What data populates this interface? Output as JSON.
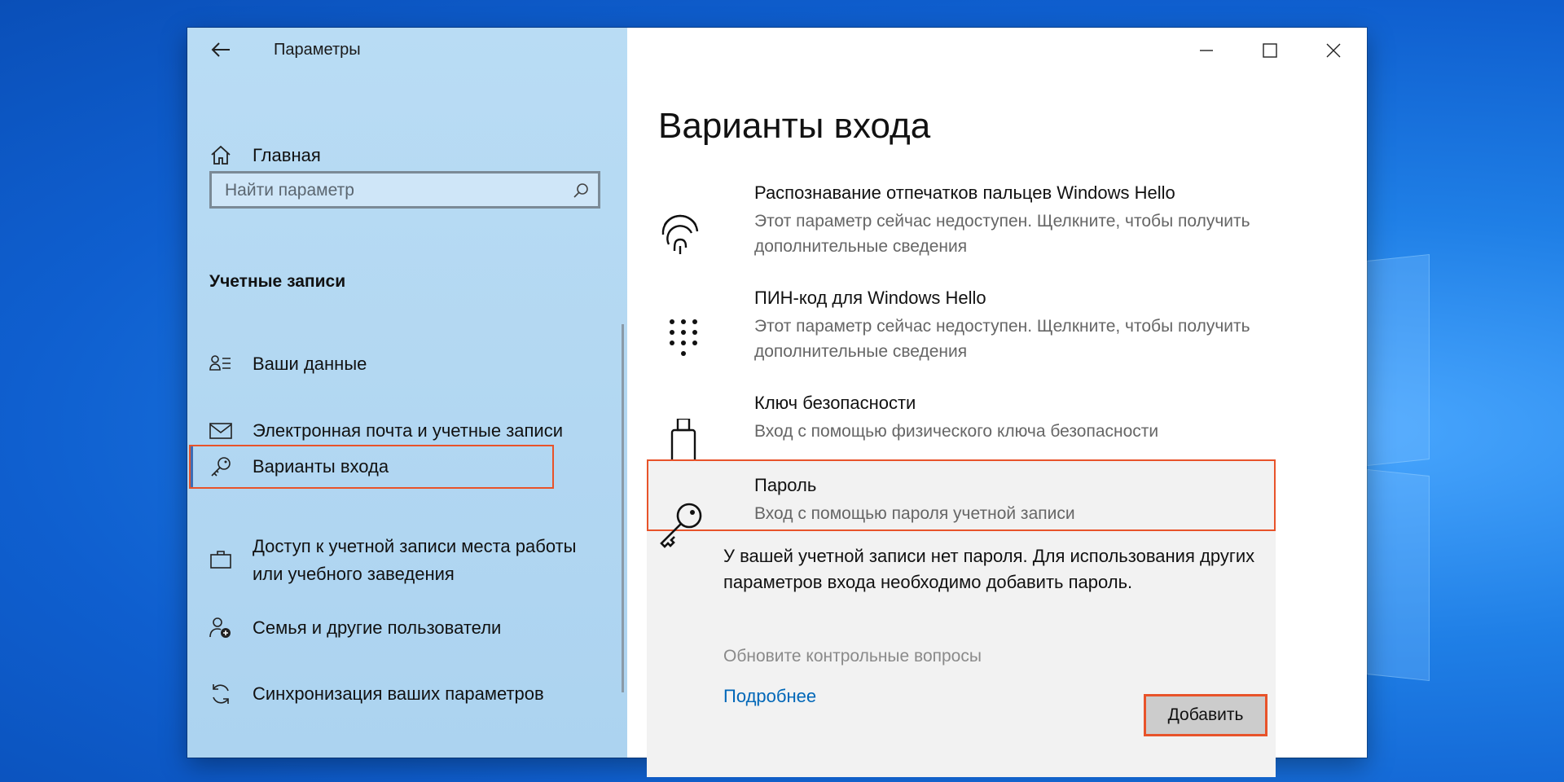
{
  "window": {
    "app_title": "Параметры",
    "controls": {
      "minimize": "minimize-icon",
      "maximize": "maximize-icon",
      "close": "close-icon"
    }
  },
  "sidebar": {
    "home_label": "Главная",
    "search_placeholder": "Найти параметр",
    "section_title": "Учетные записи",
    "items": [
      {
        "label": "Ваши данные",
        "icon": "person-list-icon"
      },
      {
        "label": "Электронная почта и учетные записи",
        "icon": "mail-icon"
      },
      {
        "label": "Варианты входа",
        "icon": "key-icon",
        "selected": true
      },
      {
        "label": "Доступ к учетной записи места работы или учебного заведения",
        "icon": "briefcase-icon"
      },
      {
        "label": "Семья и другие пользователи",
        "icon": "family-icon"
      },
      {
        "label": "Синхронизация ваших параметров",
        "icon": "sync-icon"
      }
    ]
  },
  "main": {
    "title": "Варианты входа",
    "options": [
      {
        "title": "Распознавание отпечатков пальцев Windows Hello",
        "desc": "Этот параметр сейчас недоступен. Щелкните, чтобы получить дополнительные сведения",
        "icon": "fingerprint-icon"
      },
      {
        "title": "ПИН-код для Windows Hello",
        "desc": "Этот параметр сейчас недоступен. Щелкните, чтобы получить дополнительные сведения",
        "icon": "pin-keypad-icon"
      },
      {
        "title": "Ключ безопасности",
        "desc": "Вход с помощью физического ключа безопасности",
        "icon": "usb-key-icon"
      },
      {
        "title": "Пароль",
        "desc": "Вход с помощью пароля учетной записи",
        "icon": "password-key-icon"
      }
    ],
    "password_panel": {
      "info": "У вашей учетной записи нет пароля. Для использования других параметров входа необходимо добавить пароль.",
      "update_questions": "Обновите контрольные вопросы",
      "more_link": "Подробнее",
      "add_button": "Добавить"
    }
  },
  "colors": {
    "highlight": "#e8532a",
    "sidebar_bg": "#b9dcf4",
    "link": "#0067b8"
  }
}
